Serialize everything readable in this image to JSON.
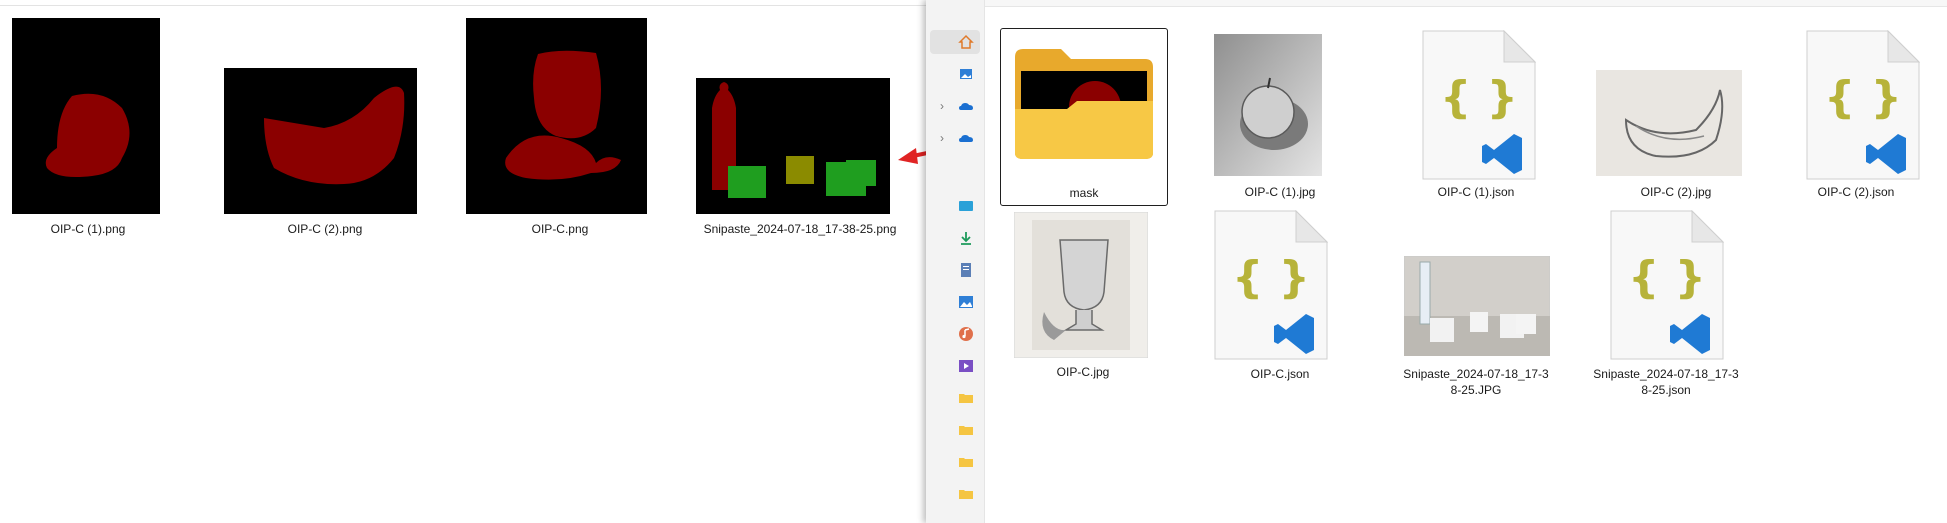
{
  "left_files": [
    {
      "name": "OIP-C (1).png"
    },
    {
      "name": "OIP-C (2).png"
    },
    {
      "name": "OIP-C.png"
    },
    {
      "name": "Snipaste_2024-07-18_17-38-25.png"
    }
  ],
  "right_files": [
    {
      "name": "mask",
      "kind": "folder"
    },
    {
      "name": "OIP-C (1).jpg",
      "kind": "image"
    },
    {
      "name": "OIP-C (1).json",
      "kind": "json"
    },
    {
      "name": "OIP-C (2).jpg",
      "kind": "image"
    },
    {
      "name": "OIP-C (2).json",
      "kind": "json"
    },
    {
      "name": "OIP-C.jpg",
      "kind": "image"
    },
    {
      "name": "OIP-C.json",
      "kind": "json"
    },
    {
      "name_line1": "Snipaste_2024-07-18_17-3",
      "name_line2": "8-25.JPG",
      "kind": "image"
    },
    {
      "name_line1": "Snipaste_2024-07-18_17-3",
      "name_line2": "8-25.json",
      "kind": "json"
    }
  ],
  "colors": {
    "mask_red": "#8b0000",
    "mask_green": "#1f9e1f",
    "mask_olive": "#8b8b00",
    "vscode_blue": "#1f7ad4",
    "json_braces": "#b7b33a",
    "folder": "#f5c542"
  },
  "nav_icons": [
    "home-icon",
    "gallery-icon",
    "onedrive-icon",
    "onedrive-icon",
    "desktop-icon",
    "downloads-icon",
    "documents-icon",
    "pictures-icon",
    "music-icon",
    "videos-icon",
    "folder-icon",
    "folder-icon",
    "folder-icon",
    "folder-icon"
  ]
}
